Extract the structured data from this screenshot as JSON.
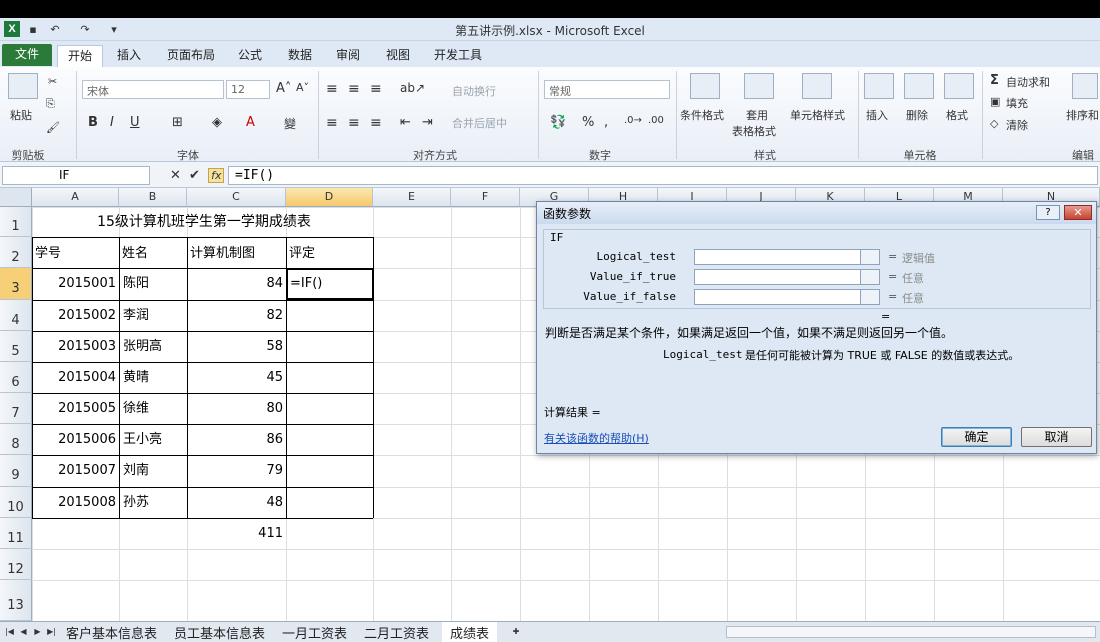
{
  "window": {
    "title": "第五讲示例.xlsx - Microsoft Excel"
  },
  "ribbon_tabs": [
    "文件",
    "开始",
    "插入",
    "页面布局",
    "公式",
    "数据",
    "审阅",
    "视图",
    "开发工具"
  ],
  "ribbon": {
    "clipboard": {
      "paste": "粘贴",
      "group": "剪贴板"
    },
    "font": {
      "font_name": "宋体",
      "font_size": "12",
      "group": "字体"
    },
    "alignment": {
      "wrap_text": "自动换行",
      "merge_center": "合并后居中",
      "group": "对齐方式"
    },
    "number": {
      "format": "常规",
      "group": "数字"
    },
    "styles": {
      "conditional": "条件格式",
      "table_format_1": "套用",
      "table_format_2": "表格格式",
      "cell_styles": "单元格样式",
      "group": "样式"
    },
    "cells": {
      "insert": "插入",
      "delete": "删除",
      "format": "格式",
      "group": "单元格"
    },
    "editing": {
      "autosum": "自动求和",
      "fill": "填充",
      "clear": "清除",
      "sort": "排序和",
      "group": "编辑"
    }
  },
  "formula_bar": {
    "name_box": "IF",
    "formula": "=IF()"
  },
  "columns": [
    "A",
    "B",
    "C",
    "D",
    "E",
    "F",
    "G",
    "H",
    "I",
    "J",
    "K",
    "L",
    "M",
    "N"
  ],
  "rows": [
    "1",
    "2",
    "3",
    "4",
    "5",
    "6",
    "7",
    "8",
    "9",
    "10",
    "11",
    "12",
    "13"
  ],
  "sheet": {
    "title": "15级计算机班学生第一学期成绩表",
    "headers": [
      "学号",
      "姓名",
      "计算机制图",
      "评定"
    ],
    "records": [
      {
        "id": "2015001",
        "name": "陈阳",
        "score": "84",
        "grade": "=IF()"
      },
      {
        "id": "2015002",
        "name": "李润",
        "score": "82",
        "grade": ""
      },
      {
        "id": "2015003",
        "name": "张明高",
        "score": "58",
        "grade": ""
      },
      {
        "id": "2015004",
        "name": "黄晴",
        "score": "45",
        "grade": ""
      },
      {
        "id": "2015005",
        "name": "徐维",
        "score": "80",
        "grade": ""
      },
      {
        "id": "2015006",
        "name": "王小亮",
        "score": "86",
        "grade": ""
      },
      {
        "id": "2015007",
        "name": "刘南",
        "score": "79",
        "grade": ""
      },
      {
        "id": "2015008",
        "name": "孙苏",
        "score": "48",
        "grade": ""
      }
    ],
    "total": "411"
  },
  "dialog": {
    "title": "函数参数",
    "function_name": "IF",
    "args": [
      {
        "label": "Logical_test",
        "hint": "逻辑值"
      },
      {
        "label": "Value_if_true",
        "hint": "任意"
      },
      {
        "label": "Value_if_false",
        "hint": "任意"
      }
    ],
    "equals": "=",
    "description": "判断是否满足某个条件，如果满足返回一个值，如果不满足则返回另一个值。",
    "arg_help_name": "Logical_test",
    "arg_help_text": "是任何可能被计算为 TRUE 或 FALSE 的数值或表达式。",
    "result_label": "计算结果 =",
    "help_link": "有关该函数的帮助(H)",
    "ok": "确定",
    "cancel": "取消",
    "help_btn": "?",
    "close_btn": "✕"
  },
  "sheet_tabs": [
    "客户基本信息表",
    "员工基本信息表",
    "一月工资表",
    "二月工资表",
    "成绩表"
  ],
  "active_sheet": "成绩表"
}
